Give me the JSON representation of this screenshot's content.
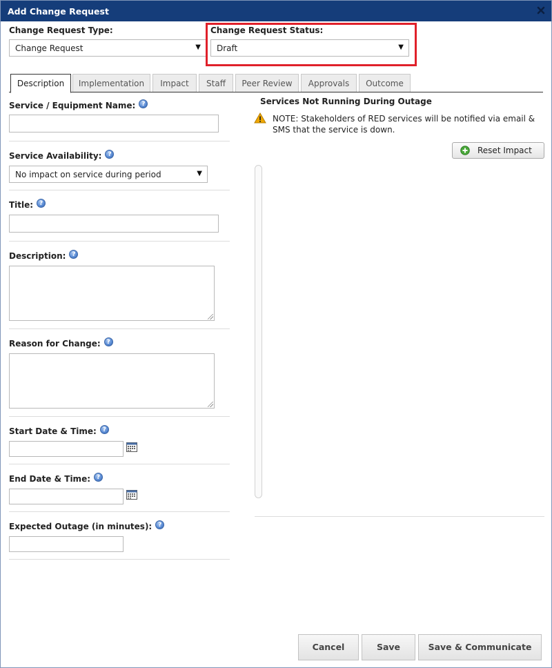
{
  "dialog": {
    "title": "Add Change Request"
  },
  "type_field": {
    "label": "Change Request Type:",
    "value": "Change Request"
  },
  "status_field": {
    "label": "Change Request Status:",
    "value": "Draft"
  },
  "tabs": [
    {
      "label": "Description",
      "active": true
    },
    {
      "label": "Implementation",
      "active": false
    },
    {
      "label": "Impact",
      "active": false
    },
    {
      "label": "Staff",
      "active": false
    },
    {
      "label": "Peer Review",
      "active": false
    },
    {
      "label": "Approvals",
      "active": false
    },
    {
      "label": "Outcome",
      "active": false
    }
  ],
  "form": {
    "service_name": {
      "label": "Service / Equipment Name:",
      "value": ""
    },
    "availability": {
      "label": "Service Availability:",
      "value": "No impact on service during period"
    },
    "title": {
      "label": "Title:",
      "value": ""
    },
    "description": {
      "label": "Description:",
      "value": ""
    },
    "reason": {
      "label": "Reason for Change:",
      "value": ""
    },
    "start": {
      "label": "Start Date & Time:",
      "value": ""
    },
    "end": {
      "label": "End Date & Time:",
      "value": ""
    },
    "outage": {
      "label": "Expected Outage (in minutes):",
      "value": ""
    }
  },
  "impact_panel": {
    "title": "Services Not Running During Outage",
    "note": "NOTE: Stakeholders of RED services will be notified via email & SMS that the service is down.",
    "reset_label": "Reset Impact"
  },
  "footer": {
    "cancel_label": "Cancel",
    "save_label": "Save",
    "save_communicate_label": "Save & Communicate"
  },
  "colors": {
    "titlebar": "#153d7a",
    "highlight": "#e0202a",
    "warning": "#f0a800",
    "help_icon": "#5d8ed6"
  }
}
